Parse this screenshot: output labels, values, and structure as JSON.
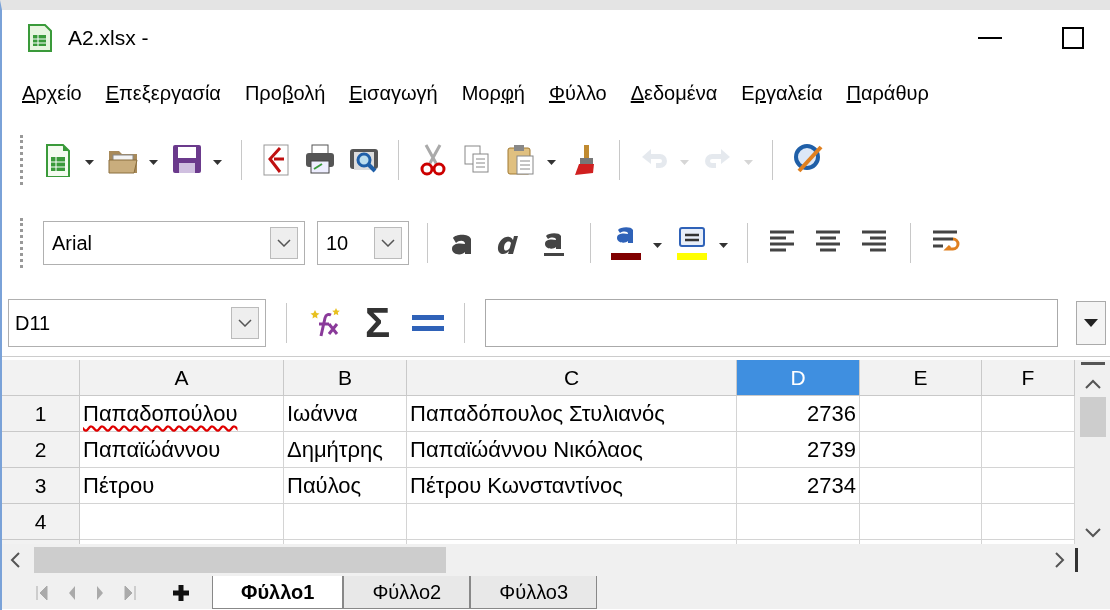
{
  "window": {
    "title": "A2.xlsx -"
  },
  "menu": [
    {
      "key": "Α",
      "after": "ρχείο"
    },
    {
      "key": "Ε",
      "after": "πεξεργασία"
    },
    {
      "before": "Προ",
      "key": "β",
      "after": "ολή"
    },
    {
      "key": "Ε",
      "after": "ισαγωγή"
    },
    {
      "before": "Μορ",
      "key": "φ",
      "after": "ή"
    },
    {
      "key": "Φ",
      "after": "ύλλο"
    },
    {
      "key": "Δ",
      "after": "εδομένα"
    },
    {
      "before": "Ε",
      "key": "ρ",
      "after": "γαλεία"
    },
    {
      "key": "Π",
      "after": "αράθυρ"
    }
  ],
  "standard_toolbar": [
    {
      "kind": "new",
      "dropdown": true,
      "disabled": false
    },
    {
      "kind": "open",
      "dropdown": true,
      "disabled": false
    },
    {
      "kind": "save",
      "dropdown": true,
      "disabled": false
    },
    {
      "kind": "separator"
    },
    {
      "kind": "pdf",
      "dropdown": false,
      "disabled": false
    },
    {
      "kind": "print",
      "dropdown": false,
      "disabled": false
    },
    {
      "kind": "preview",
      "dropdown": false,
      "disabled": false
    },
    {
      "kind": "separator"
    },
    {
      "kind": "cut",
      "dropdown": false,
      "disabled": false
    },
    {
      "kind": "copy",
      "dropdown": false,
      "disabled": false
    },
    {
      "kind": "paste",
      "dropdown": true,
      "disabled": false
    },
    {
      "kind": "clone",
      "dropdown": false,
      "disabled": false
    },
    {
      "kind": "separator"
    },
    {
      "kind": "undo",
      "dropdown": true,
      "disabled": true
    },
    {
      "kind": "redo",
      "dropdown": true,
      "disabled": true
    },
    {
      "kind": "separator"
    },
    {
      "kind": "spell",
      "dropdown": false,
      "disabled": false
    }
  ],
  "formatting_toolbar": {
    "font_name": "Arial",
    "font_size": "10",
    "items": [
      {
        "kind": "bold",
        "dropdown": false
      },
      {
        "kind": "italic",
        "dropdown": false
      },
      {
        "kind": "underline",
        "dropdown": false
      },
      {
        "kind": "separator"
      },
      {
        "kind": "fontcolor",
        "dropdown": true,
        "color": "#800000"
      },
      {
        "kind": "highlight",
        "dropdown": true,
        "color": "#ffff00"
      },
      {
        "kind": "separator"
      },
      {
        "kind": "alignleft",
        "dropdown": false
      },
      {
        "kind": "aligncenter",
        "dropdown": false
      },
      {
        "kind": "alignright",
        "dropdown": false
      },
      {
        "kind": "separator"
      },
      {
        "kind": "wrap",
        "dropdown": false
      }
    ]
  },
  "formula_bar": {
    "name_box": "D11",
    "sum_symbol": "Σ"
  },
  "columns": [
    {
      "label": "A",
      "selected": false
    },
    {
      "label": "B",
      "selected": false
    },
    {
      "label": "C",
      "selected": false
    },
    {
      "label": "D",
      "selected": true
    },
    {
      "label": "E",
      "selected": false
    },
    {
      "label": "F",
      "selected": false
    }
  ],
  "rows": [
    {
      "header": "1",
      "cells": [
        {
          "text": "Παπαδοπούλου",
          "misspelled": true,
          "numeric": false
        },
        {
          "text": "Ιωάννα",
          "misspelled": false,
          "numeric": false
        },
        {
          "text": "Παπαδόπουλος Στυλιανός",
          "misspelled": false,
          "numeric": false
        },
        {
          "text": "2736",
          "misspelled": false,
          "numeric": true
        }
      ]
    },
    {
      "header": "2",
      "cells": [
        {
          "text": "Παπαϊώάννου",
          "misspelled": false,
          "numeric": false
        },
        {
          "text": "Δημήτρης",
          "misspelled": false,
          "numeric": false
        },
        {
          "text": "Παπαϊώάννου Νικόλαος",
          "misspelled": false,
          "numeric": false
        },
        {
          "text": "2739",
          "misspelled": false,
          "numeric": true
        }
      ]
    },
    {
      "header": "3",
      "cells": [
        {
          "text": "Πέτρου",
          "misspelled": false,
          "numeric": false
        },
        {
          "text": "Παύλος",
          "misspelled": false,
          "numeric": false
        },
        {
          "text": "Πέτρου Κωνσταντίνος",
          "misspelled": false,
          "numeric": false
        },
        {
          "text": "2734",
          "misspelled": false,
          "numeric": true
        }
      ]
    },
    {
      "header": "4",
      "cells": []
    }
  ],
  "sheet_tabs": [
    {
      "label": "Φύλλο1",
      "selected": true
    },
    {
      "label": "Φύλλο2",
      "selected": false
    },
    {
      "label": "Φύλλο3",
      "selected": false
    }
  ]
}
